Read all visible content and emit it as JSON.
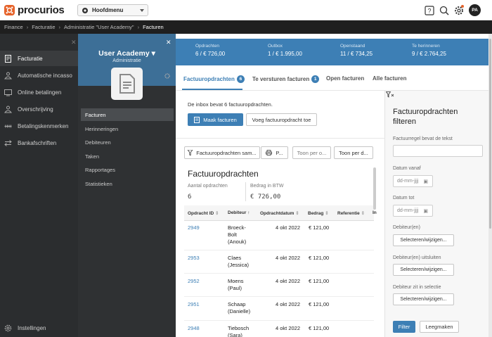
{
  "app": {
    "name": "procurios"
  },
  "topbar": {
    "main_menu_label": "Hoofdmenu",
    "avatar_initials": "PA"
  },
  "breadcrumb": [
    "Finance",
    "Facturatie",
    "Administratie \"User Academy\"",
    "Facturen"
  ],
  "leftnav": {
    "items": [
      {
        "label": "Facturatie",
        "icon": "invoice-icon",
        "active": true
      },
      {
        "label": "Automatische incasso",
        "icon": "direct-debit-icon"
      },
      {
        "label": "Online betalingen",
        "icon": "online-payment-icon"
      },
      {
        "label": "Overschrijving",
        "icon": "transfer-icon"
      },
      {
        "label": "Betalingskenmerken",
        "icon": "payment-reference-icon"
      },
      {
        "label": "Bankafschriften",
        "icon": "bank-statement-icon"
      }
    ],
    "settings_label": "Instellingen"
  },
  "subnav": {
    "title": "User Academy",
    "subtitle": "Administratie",
    "items": [
      {
        "label": "Facturen",
        "active": true
      },
      {
        "label": "Herinneringen"
      },
      {
        "label": "Debiteuren"
      },
      {
        "label": "Taken"
      },
      {
        "label": "Rapportages"
      },
      {
        "label": "Statistieken"
      }
    ]
  },
  "stats": [
    {
      "label": "Opdrachten",
      "value": "6 / € 726,00"
    },
    {
      "label": "Outbox",
      "value": "1 / € 1.995,00"
    },
    {
      "label": "Openstaand",
      "value": "11 / € 734,25"
    },
    {
      "label": "Te herinneren",
      "value": "9 / € 2.764,25"
    }
  ],
  "tabs": [
    {
      "label": "Factuuropdrachten",
      "badge": "6",
      "active": true
    },
    {
      "label": "Te versturen facturen",
      "badge": "1"
    },
    {
      "label": "Open facturen"
    },
    {
      "label": "Alle facturen"
    }
  ],
  "inbox": {
    "text": "De inbox bevat 6 factuuropdrachten.",
    "make_invoices": "Maak facturen",
    "add_order": "Voeg factuuropdracht toe"
  },
  "toolbar": {
    "filter_label": "Factuuropdrachten sam...",
    "print_label": "P...",
    "show_per_1": "Toon per o...",
    "show_per_2": "Toon per d..."
  },
  "summary": {
    "title": "Factuuropdrachten",
    "count_label": "Aantal opdrachten",
    "count_value": "6",
    "btw_label": "Bedrag in BTW",
    "btw_value": "€ 726,00"
  },
  "table": {
    "columns": [
      "Opdracht ID",
      "Debiteur",
      "Opdrachtdatum",
      "Bedrag",
      "Referentie",
      "In"
    ],
    "rows": [
      {
        "id": "2949",
        "debtor": [
          "Broeck-",
          "Bolt",
          "(Anouk)"
        ],
        "date": "4 okt 2022",
        "amount": "€ 121,00"
      },
      {
        "id": "2953",
        "debtor": [
          "Claes",
          "(Jessica)"
        ],
        "date": "4 okt 2022",
        "amount": "€ 121,00"
      },
      {
        "id": "2952",
        "debtor": [
          "Moens",
          "(Paul)"
        ],
        "date": "4 okt 2022",
        "amount": "€ 121,00"
      },
      {
        "id": "2951",
        "debtor": [
          "Schaap",
          "(Danielle)"
        ],
        "date": "4 okt 2022",
        "amount": "€ 121,00"
      },
      {
        "id": "2948",
        "debtor": [
          "Tiebosch",
          "(Sara)"
        ],
        "date": "4 okt 2022",
        "amount": "€ 121,00"
      }
    ]
  },
  "filter": {
    "title": "Factuuropdrachten filteren",
    "text_label": "Factuurregel bevat de tekst",
    "date_from_label": "Datum vanaf",
    "date_to_label": "Datum tot",
    "date_placeholder": "dd-mm-jjjj",
    "debtor_label": "Debiteur(en)",
    "exclude_label": "Debiteur(en) uitsluiten",
    "selection_label": "Debiteur zit in selectie",
    "select_button": "Selecteren/wijzigen...",
    "filter_button": "Filter",
    "clear_button": "Leegmaken"
  },
  "colors": {
    "accent": "#3d7fb5",
    "brand_orange": "#e6632a",
    "nav_dark": "#2b2d2f"
  }
}
